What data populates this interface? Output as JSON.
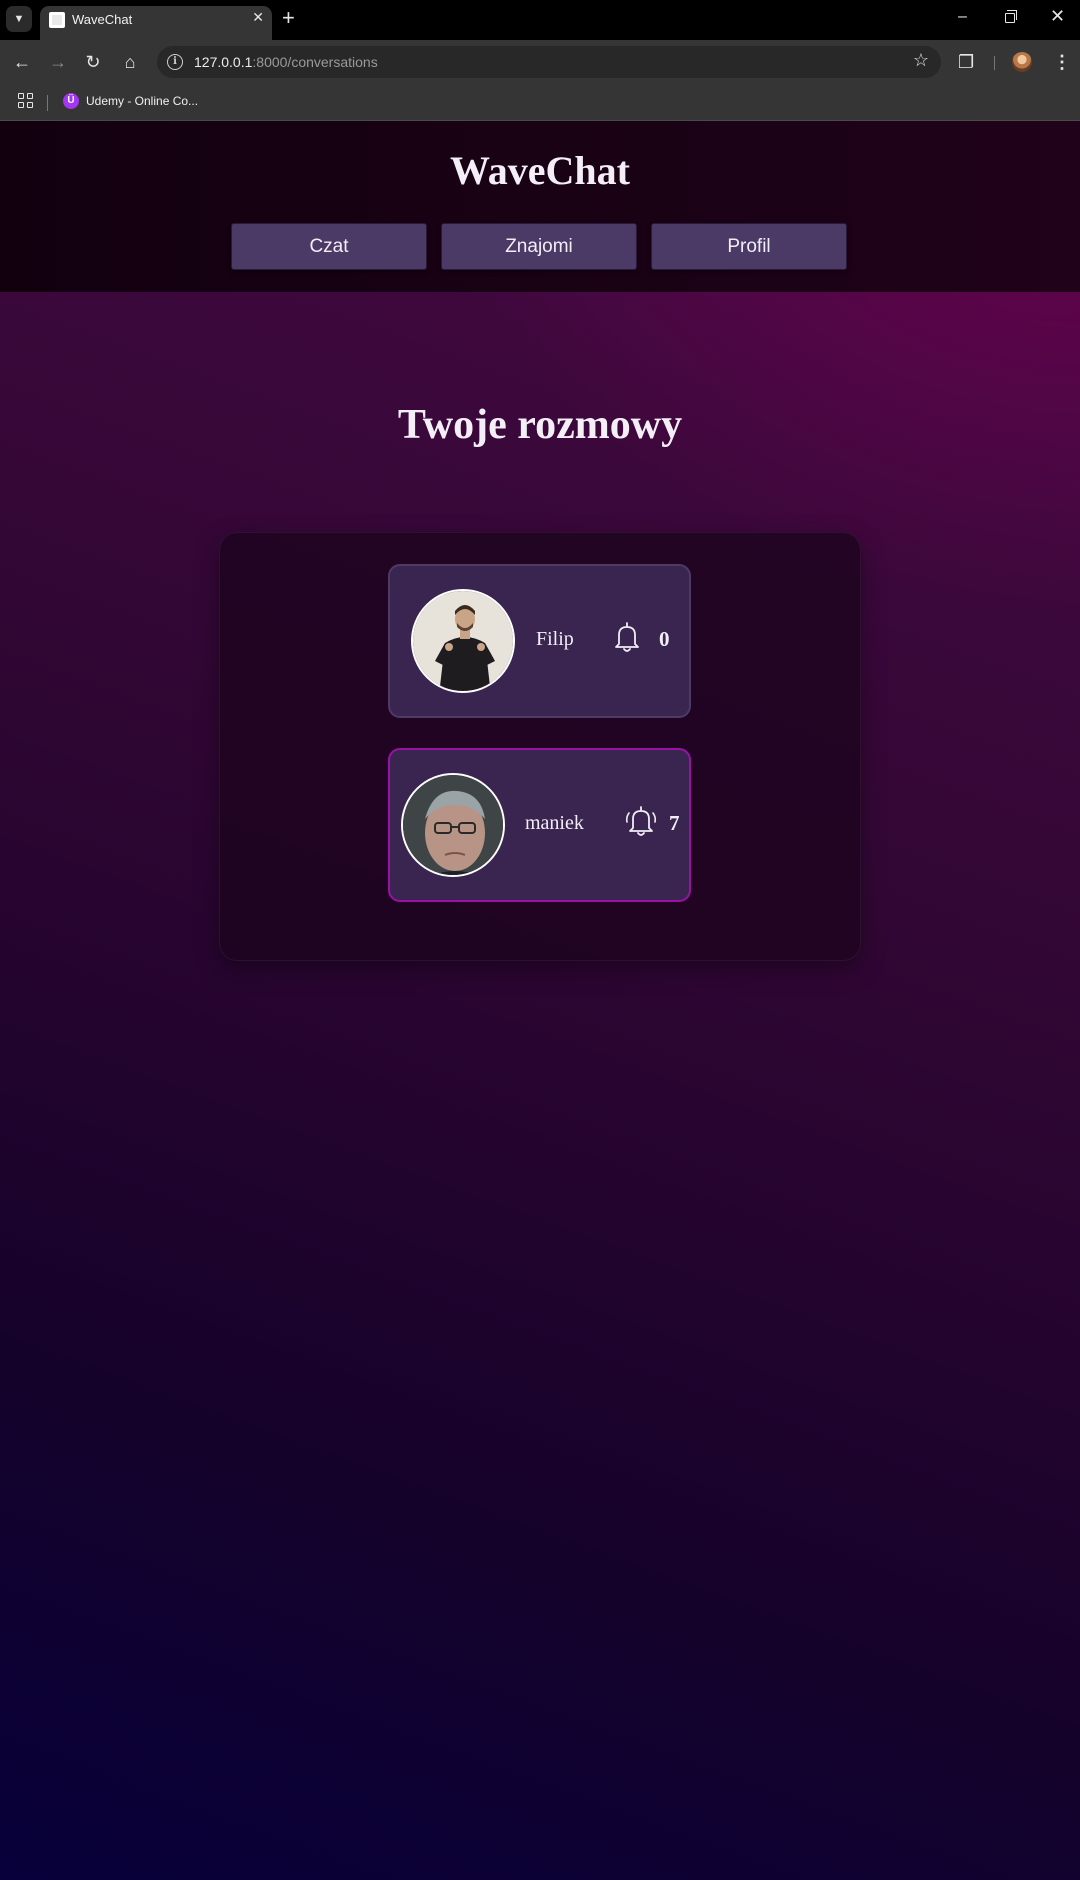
{
  "browser": {
    "tab_title": "WaveChat",
    "url_host": "127.0.0.1",
    "url_rest": ":8000/conversations",
    "bookmark_label": "Udemy - Online Co...",
    "bookmark_icon_letter": "Ü"
  },
  "app": {
    "brand": "WaveChat",
    "nav": [
      {
        "label": "Czat"
      },
      {
        "label": "Znajomi"
      },
      {
        "label": "Profil"
      }
    ],
    "heading": "Twoje rozmowy"
  },
  "conversations": [
    {
      "name": "Filip",
      "notifications": "0",
      "active": false,
      "avatar": "man-in-dark-suit-photo"
    },
    {
      "name": "maniek",
      "notifications": "7",
      "active": true,
      "avatar": "older-man-with-glasses-photo"
    }
  ],
  "colors": {
    "nav_button": "#4b3a66",
    "card": "#3a2550",
    "active_border": "#9a11a6"
  }
}
